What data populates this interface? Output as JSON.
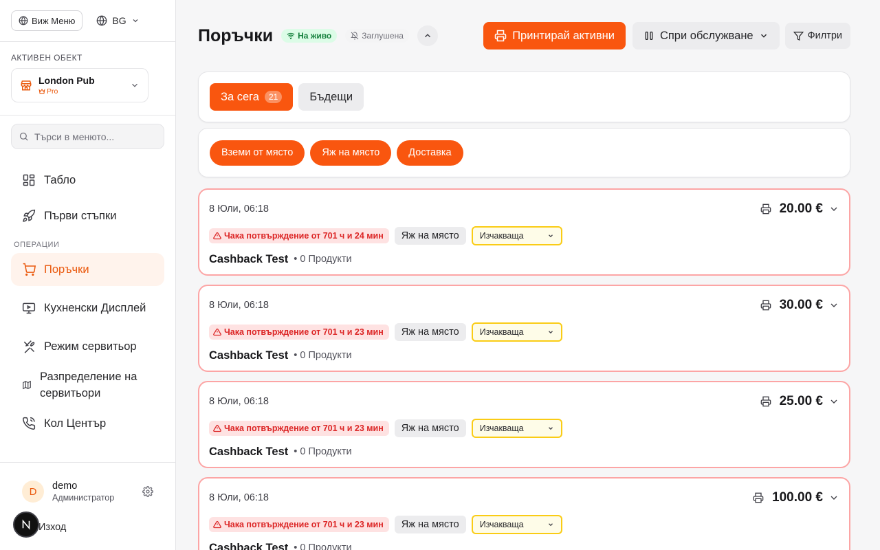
{
  "sidebar": {
    "view_menu_label": "Виж Меню",
    "language": "BG",
    "active_object_label": "АКТИВЕН ОБЕКТ",
    "venue": {
      "name": "London Pub",
      "plan": "Pro"
    },
    "search_placeholder": "Търси в менюто...",
    "items_top": [
      {
        "label": "Табло",
        "icon": "dashboard-icon"
      },
      {
        "label": "Първи стъпки",
        "icon": "rocket-icon"
      }
    ],
    "operations_label": "ОПЕРАЦИИ",
    "items_ops": [
      {
        "label": "Поръчки",
        "icon": "cart-icon",
        "active": true
      },
      {
        "label": "Кухненски Дисплей",
        "icon": "monitor-icon"
      },
      {
        "label": "Режим сервитьор",
        "icon": "utensils-icon"
      },
      {
        "label": "Разпределение на сервитьори",
        "icon": "map-icon"
      },
      {
        "label": "Кол Център",
        "icon": "phone-icon"
      }
    ],
    "user": {
      "initial": "D",
      "name": "demo",
      "role": "Администратор"
    },
    "logout_label": "Изход"
  },
  "header": {
    "title": "Поръчки",
    "live_label": "На живо",
    "muted_label": "Заглушена",
    "print_active_label": "Принтирай активни",
    "stop_service_label": "Спри обслужване",
    "filters_label": "Филтри"
  },
  "tabs": [
    {
      "label": "За сега",
      "count": "21",
      "active": true
    },
    {
      "label": "Бъдещи",
      "active": false
    }
  ],
  "order_types": [
    "Вземи от място",
    "Яж на място",
    "Доставка"
  ],
  "orders": [
    {
      "date": "8 Юли, 06:18",
      "total": "20.00 €",
      "awaiting": "Чака потвърждение от 701 ч и 24 мин",
      "type": "Яж на място",
      "status": "Изчакваща",
      "customer": "Cashback Test",
      "products": "0 Продукти"
    },
    {
      "date": "8 Юли, 06:18",
      "total": "30.00 €",
      "awaiting": "Чака потвърждение от 701 ч и 23 мин",
      "type": "Яж на място",
      "status": "Изчакваща",
      "customer": "Cashback Test",
      "products": "0 Продукти"
    },
    {
      "date": "8 Юли, 06:18",
      "total": "25.00 €",
      "awaiting": "Чака потвърждение от 701 ч и 23 мин",
      "type": "Яж на място",
      "status": "Изчакваща",
      "customer": "Cashback Test",
      "products": "0 Продукти"
    },
    {
      "date": "8 Юли, 06:18",
      "total": "100.00 €",
      "awaiting": "Чака потвърждение от 701 ч и 23 мин",
      "type": "Яж на място",
      "status": "Изчакваща",
      "customer": "Cashback Test",
      "products": "0 Продукти"
    }
  ],
  "colors": {
    "accent": "#f9560f",
    "order_border": "#fca5a5",
    "awaiting_text": "#dc2626",
    "status_border": "#facc15",
    "live_green": "#15803d"
  }
}
